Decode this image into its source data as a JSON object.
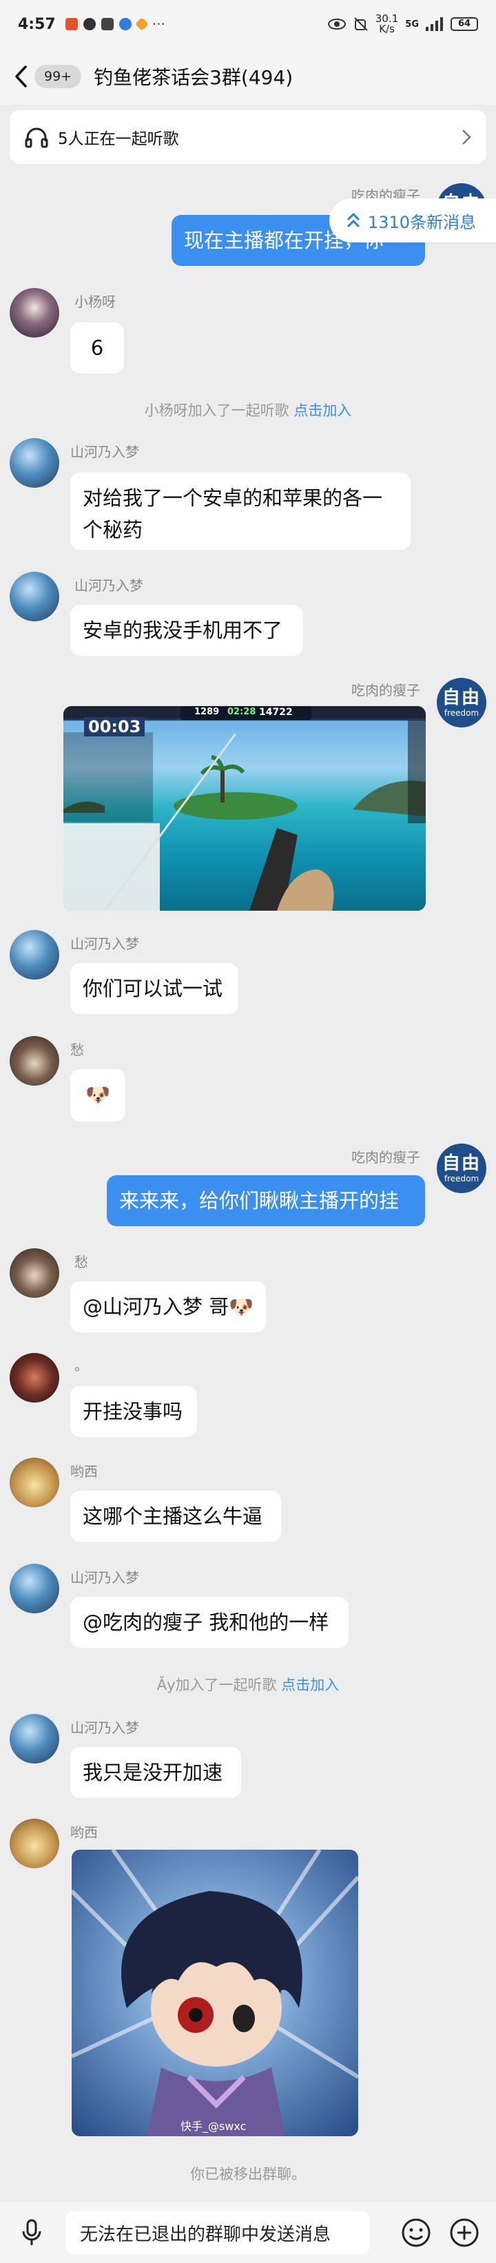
{
  "status_bar": {
    "time": "4:57",
    "dots": "···",
    "net_speed_value": "30.1",
    "net_speed_unit": "K/s",
    "signal": "5G",
    "battery": "64"
  },
  "header": {
    "unread_badge": "99+",
    "title": "钓鱼佬茶话会3群(494)"
  },
  "listen_bar": {
    "text": "5人正在一起听歌"
  },
  "new_messages": {
    "text": "1310条新消息"
  },
  "messages": [
    {
      "sender": "吃肉的瘦子",
      "text": "现在主播都在开挂，你"
    },
    {
      "sender": "小杨呀",
      "text": "6"
    },
    {
      "sender": "山河乃入梦",
      "text": "对给我了一个安卓的和苹果的各一个秘药"
    },
    {
      "sender": "山河乃入梦",
      "text": "安卓的我没手机用不了"
    },
    {
      "sender": "吃肉的瘦子",
      "text": ""
    },
    {
      "sender": "山河乃入梦",
      "text": "你们可以试一试"
    },
    {
      "sender": "愁",
      "text": "🐶"
    },
    {
      "sender": "吃肉的瘦子",
      "text": "来来来，给你们瞅瞅主播开的挂"
    },
    {
      "sender": "愁",
      "text": "@山河乃入梦 哥🐶"
    },
    {
      "sender": "。",
      "text": "开挂没事吗"
    },
    {
      "sender": "哟西",
      "text": "这哪个主播这么牛逼"
    },
    {
      "sender": "山河乃入梦",
      "text": "@吃肉的瘦子 我和他的一样"
    },
    {
      "sender": "山河乃入梦",
      "text": "我只是没开加速"
    },
    {
      "sender": "哟西",
      "text": ""
    }
  ],
  "system_notes": [
    {
      "text": "小杨呀加入了一起听歌 ",
      "link": "点击加入"
    },
    {
      "text": "Ǎy加入了一起听歌 ",
      "link": "点击加入"
    },
    {
      "text": "你已被移出群聊。",
      "link": ""
    }
  ],
  "game_image": {
    "hud_score": "1289",
    "hud_timer": "02:28",
    "hud_coins": "14722",
    "big_timer": "00:03"
  },
  "anime_image": {
    "caption": "快手_@swxc"
  },
  "avatar_freedom": {
    "big": "自由",
    "small": "freedom"
  },
  "input_bar": {
    "disabled_text": "无法在已退出的群聊中发送消息"
  },
  "colors": {
    "accent": "#3b8ff0",
    "background": "#ededed",
    "bubble_in": "#ffffff",
    "bubble_out": "#3b8ff0"
  }
}
